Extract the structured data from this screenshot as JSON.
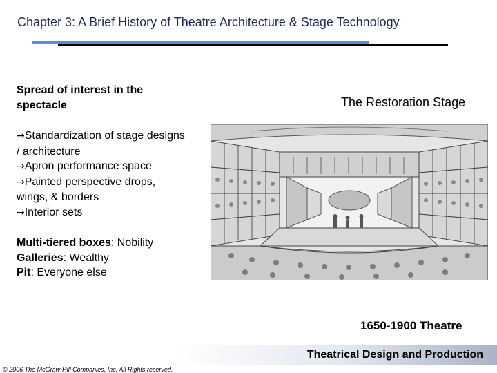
{
  "slide": {
    "title": "Chapter 3:  A Brief History of Theatre Architecture & Stage Technology",
    "left": {
      "heading": "Spread of interest in the spectacle",
      "bullets": [
        "Standardization of stage designs / architecture",
        "Apron performance space",
        "Painted perspective drops, wings, & borders",
        "Interior sets"
      ],
      "tiers": [
        {
          "label": "Multi-tiered boxes",
          "value": " Nobility"
        },
        {
          "label": "Galleries",
          "value": " Wealthy"
        },
        {
          "label": "Pit",
          "value": "  Everyone else"
        }
      ]
    },
    "image_title": "The Restoration Stage",
    "era": "1650-1900 Theatre",
    "footer": "Theatrical Design and Production",
    "copyright": "© 2006 The McGraw-Hill Companies, Inc. All Rights reserved."
  },
  "icons": {
    "bullet": "right-arrow-icon",
    "illustration": "restoration-stage-illustration"
  },
  "colors": {
    "title": "#1f2a56",
    "rule_blue": "#6a84d8",
    "rule_black": "#000000"
  }
}
